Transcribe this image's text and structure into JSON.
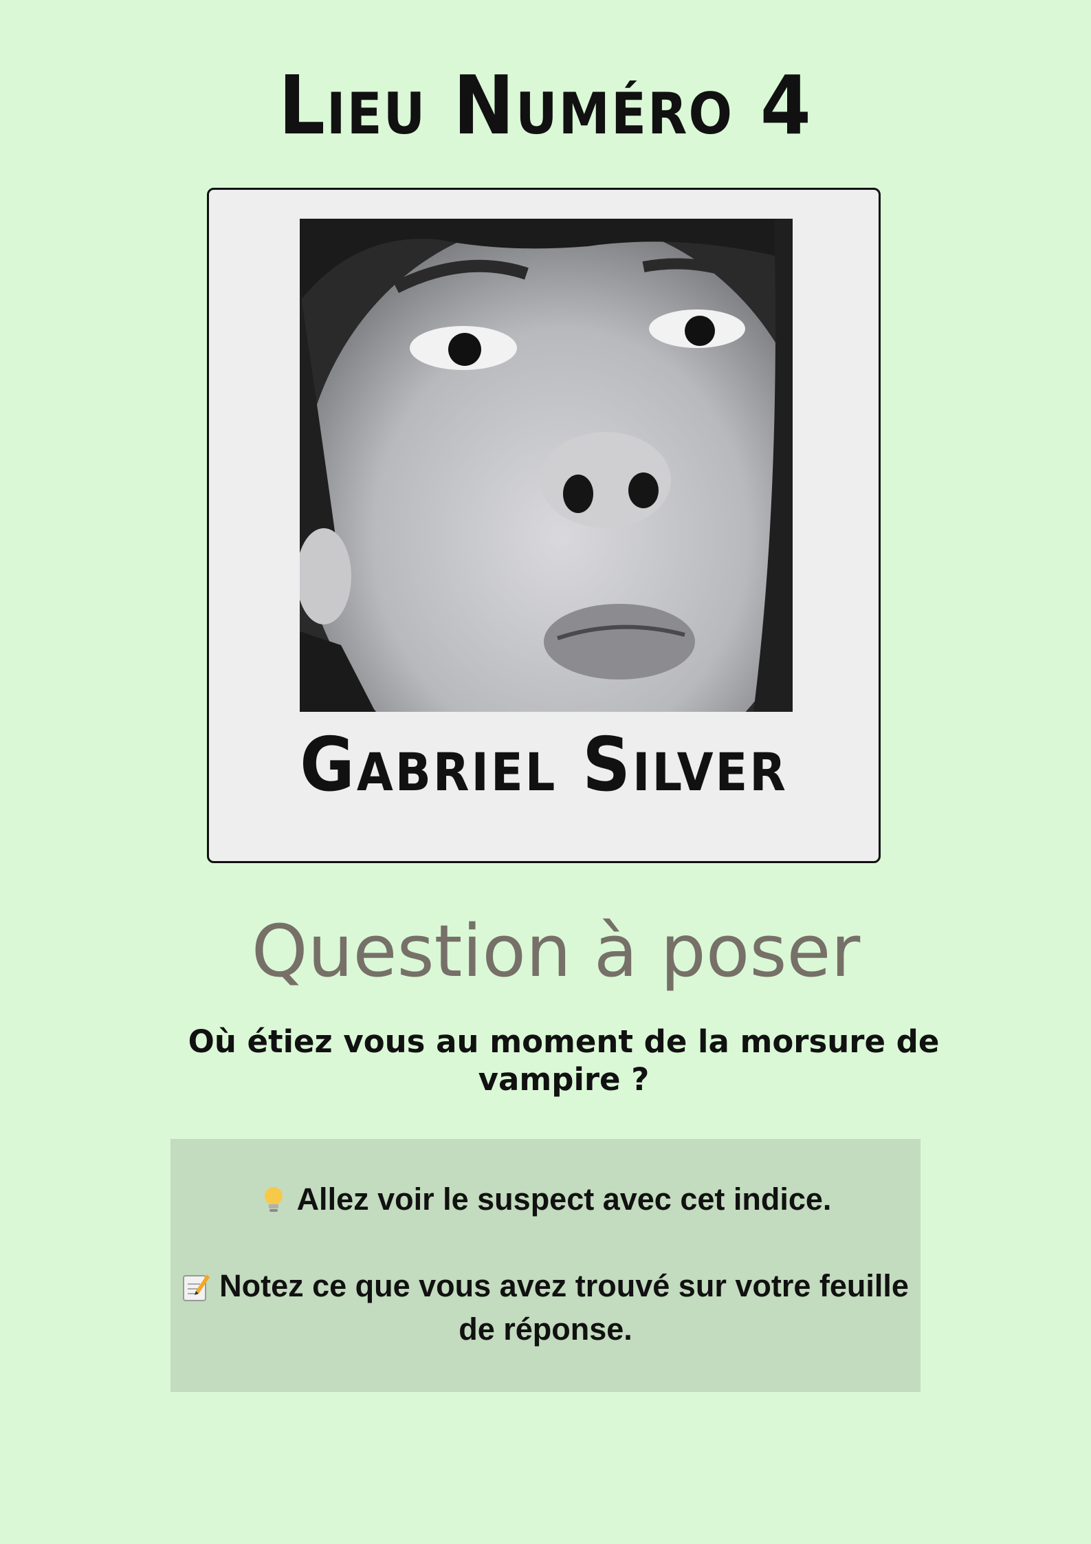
{
  "page": {
    "title": "Lieu Numéro 4"
  },
  "suspect": {
    "name": "Gabriel Silver",
    "photo_description_icon": "portrait-photo"
  },
  "question": {
    "heading": "Question à poser",
    "text": "Où étiez vous au moment de la morsure de vampire ?"
  },
  "instructions": {
    "line1_icon": "lightbulb-icon",
    "line1": "Allez voir le suspect avec cet indice.",
    "line2_icon": "memo-icon",
    "line2": "Notez ce que vous avez trouvé sur votre feuille de réponse."
  },
  "colors": {
    "background": "#daf8d6",
    "card": "#eeeeee",
    "heading_grey": "#767068",
    "instruction_box": "#c3dbbe"
  }
}
